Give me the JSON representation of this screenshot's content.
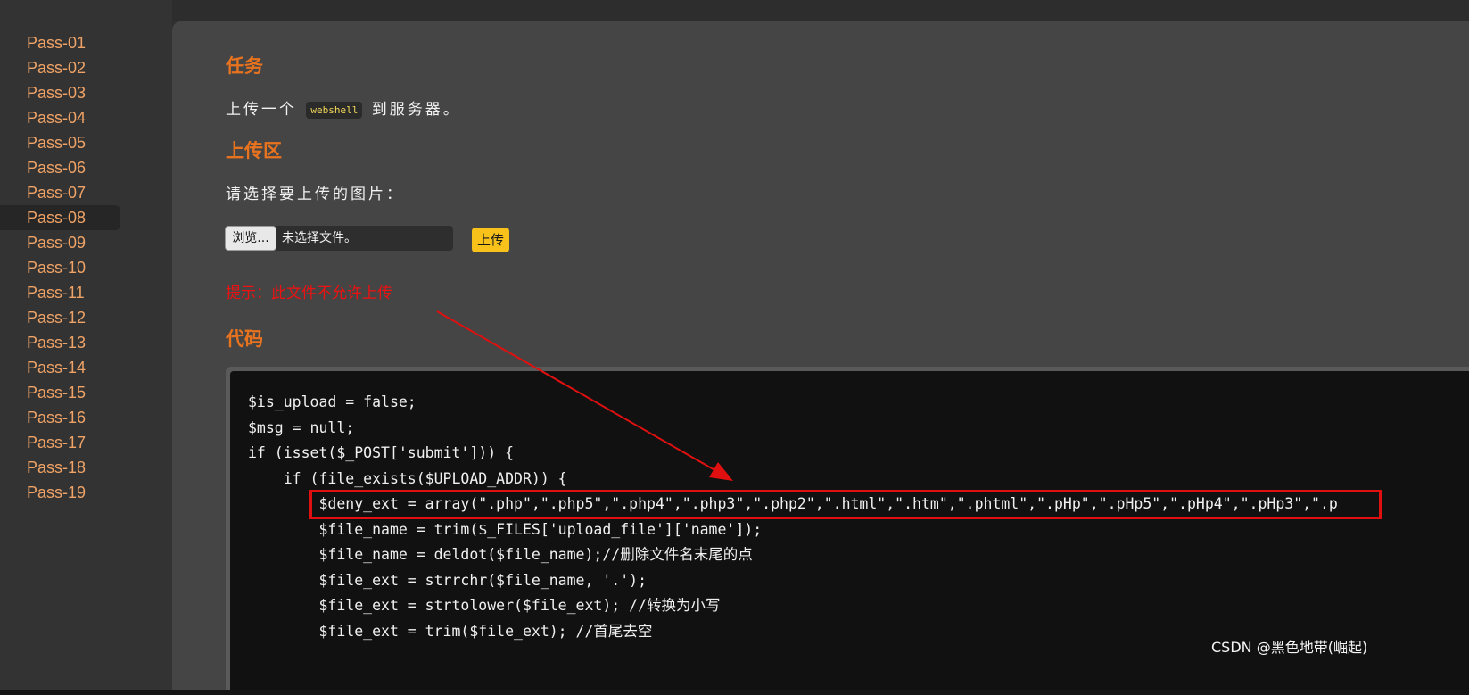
{
  "sidebar": {
    "items": [
      "Pass-01",
      "Pass-02",
      "Pass-03",
      "Pass-04",
      "Pass-05",
      "Pass-06",
      "Pass-07",
      "Pass-08",
      "Pass-09",
      "Pass-10",
      "Pass-11",
      "Pass-12",
      "Pass-13",
      "Pass-14",
      "Pass-15",
      "Pass-16",
      "Pass-17",
      "Pass-18",
      "Pass-19"
    ],
    "active": "Pass-08"
  },
  "task": {
    "heading": "任务",
    "text_before": "上传一个",
    "code": "webshell",
    "text_after": "到服务器。"
  },
  "upload": {
    "heading": "上传区",
    "prompt": "请选择要上传的图片：",
    "browse_label": "浏览...",
    "file_status": "未选择文件。",
    "submit_label": "上传",
    "hint": "提示：此文件不允许上传"
  },
  "code": {
    "heading": "代码",
    "lines": [
      "$is_upload = false;",
      "$msg = null;",
      "if (isset($_POST['submit'])) {",
      "    if (file_exists($UPLOAD_ADDR)) {",
      "        $deny_ext = array(\".php\",\".php5\",\".php4\",\".php3\",\".php2\",\".html\",\".htm\",\".phtml\",\".pHp\",\".pHp5\",\".pHp4\",\".pHp3\",\".p",
      "        $file_name = trim($_FILES['upload_file']['name']);",
      "        $file_name = deldot($file_name);//删除文件名末尾的点",
      "        $file_ext = strrchr($file_name, '.');",
      "        $file_ext = strtolower($file_ext); //转换为小写",
      "        $file_ext = trim($file_ext); //首尾去空"
    ]
  },
  "watermark": "CSDN @黑色地带(崛起)",
  "colors": {
    "accent": "#e8731f",
    "nav_link": "#f0a366",
    "hint": "#ee1111",
    "annotation": "#e01010",
    "upload_button": "#f8c21a"
  },
  "icons": {
    "annotation_arrow": "arrow-icon"
  }
}
